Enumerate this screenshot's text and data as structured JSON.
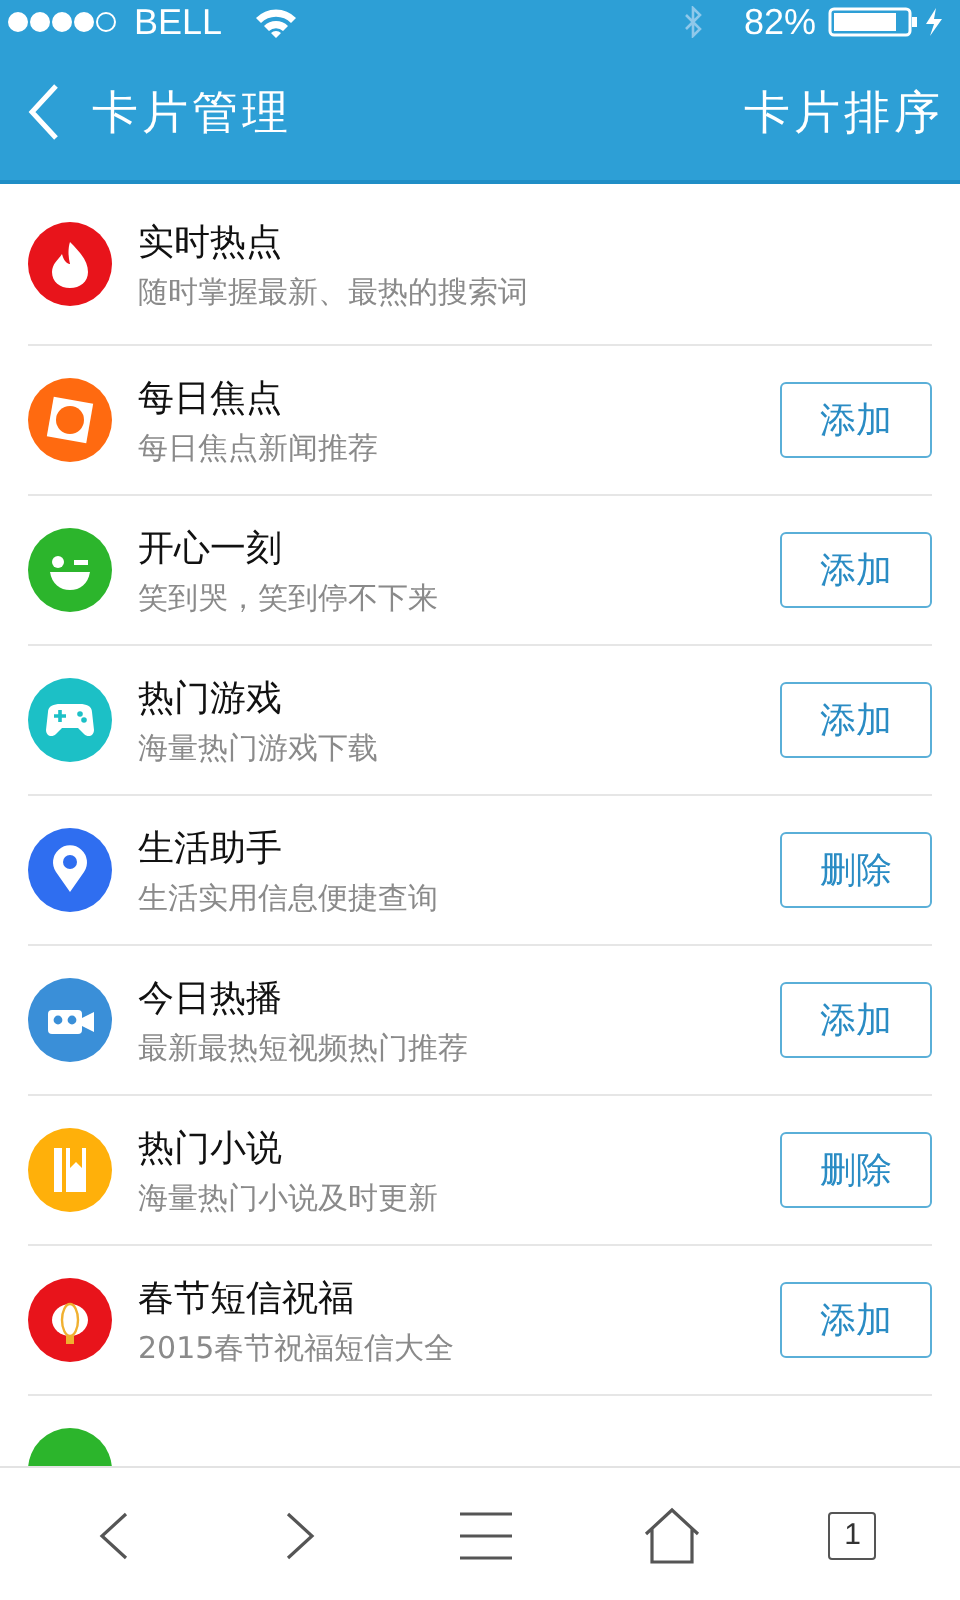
{
  "status_bar": {
    "carrier": "BELL",
    "battery_text": "82%"
  },
  "header": {
    "back_label": "卡片管理",
    "action": "卡片排序"
  },
  "cards": [
    {
      "kind": "flame",
      "color": "#e8141b",
      "title": "实时热点",
      "subtitle": "随时掌握最新、最热的搜索词"
    },
    {
      "kind": "focus",
      "color": "#ff6a10",
      "title": "每日焦点",
      "subtitle": "每日焦点新闻推荐",
      "button": {
        "label": "添加"
      }
    },
    {
      "kind": "smile",
      "color": "#2cb52c",
      "title": "开心一刻",
      "subtitle": "笑到哭，笑到停不下来",
      "button": {
        "label": "添加"
      }
    },
    {
      "kind": "gamepad",
      "color": "#1cc0c6",
      "title": "热门游戏",
      "subtitle": "海量热门游戏下载",
      "button": {
        "label": "添加"
      }
    },
    {
      "kind": "pin",
      "color": "#2f6ef0",
      "title": "生活助手",
      "subtitle": "生活实用信息便捷查询",
      "button": {
        "label": "删除"
      }
    },
    {
      "kind": "camera",
      "color": "#3a8fd8",
      "title": "今日热播",
      "subtitle": "最新最热短视频热门推荐",
      "button": {
        "label": "添加"
      }
    },
    {
      "kind": "book",
      "color": "#ffb00a",
      "title": "热门小说",
      "subtitle": "海量热门小说及时更新",
      "button": {
        "label": "删除"
      }
    },
    {
      "kind": "lantern",
      "color": "#e8141b",
      "title": "春节短信祝福",
      "subtitle": "2015春节祝福短信大全",
      "button": {
        "label": "添加"
      }
    },
    {
      "kind": "plain",
      "color": "#2cb52c"
    }
  ],
  "tab_count": "1"
}
